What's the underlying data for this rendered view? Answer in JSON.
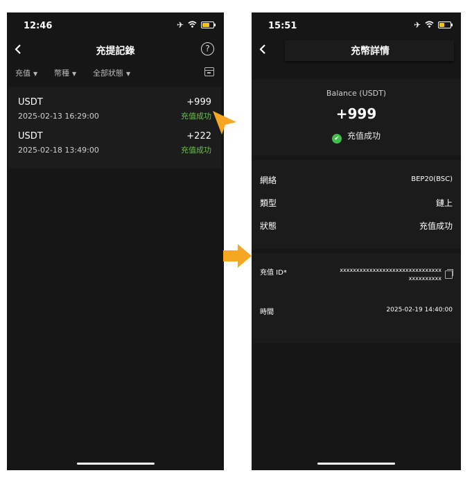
{
  "left": {
    "status_time": "12:46",
    "title": "充提記錄",
    "filters": [
      "充值",
      "幣種",
      "全部狀態"
    ],
    "records": [
      {
        "coin": "USDT",
        "time": "2025-02-13 16:29:00",
        "amount": "+999",
        "status": "充值成功"
      },
      {
        "coin": "USDT",
        "time": "2025-02-18 13:49:00",
        "amount": "+222",
        "status": "充值成功"
      }
    ]
  },
  "right": {
    "status_time": "15:51",
    "title": "充幣詳情",
    "balance_label": "Balance (USDT)",
    "amount": "+999",
    "status": "充值成功",
    "info": [
      {
        "label": "網絡",
        "value": "BEP20(BSC)"
      },
      {
        "label": "類型",
        "value": "鏈上"
      },
      {
        "label": "狀態",
        "value": "充值成功"
      }
    ],
    "id_label": "充值 ID*",
    "id_value": "xxxxxxxxxxxxxxxxxxxxxxxxxxxxxxxxxxxxxxxxx",
    "time_label": "時間",
    "time_value": "2025-02-19 14:40:00"
  },
  "colors": {
    "success": "#6cc04a",
    "accent": "#f5a623",
    "background": "#161616",
    "battery": "#f2c51b"
  },
  "icons": [
    "back-icon",
    "help-icon",
    "calendar-icon",
    "airplane-icon",
    "wifi-icon",
    "battery-icon",
    "check-icon",
    "copy-icon",
    "arrow-pointer-icon",
    "arrow-right-icon"
  ]
}
